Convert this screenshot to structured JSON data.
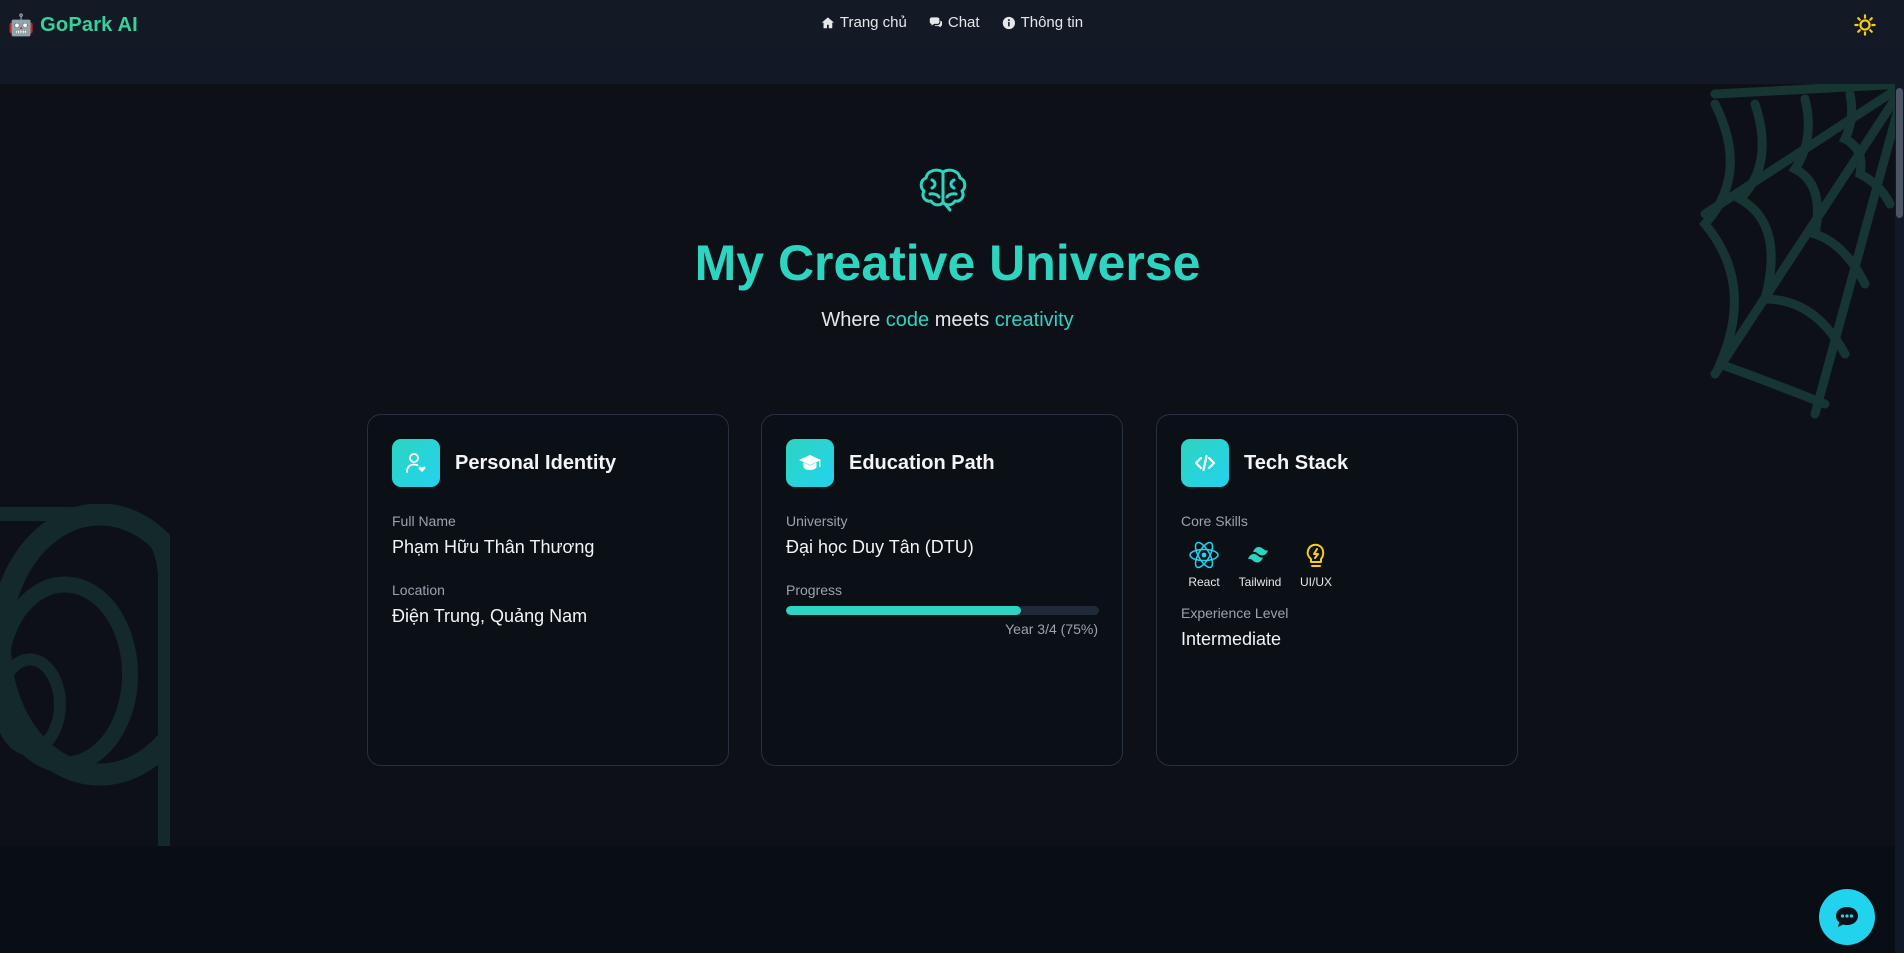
{
  "navbar": {
    "brand_icon": "🤖",
    "brand": "GoPark AI",
    "links": [
      {
        "icon": "home-icon",
        "label": "Trang chủ"
      },
      {
        "icon": "comments-icon",
        "label": "Chat"
      },
      {
        "icon": "info-icon",
        "label": "Thông tin"
      }
    ],
    "theme_icon": "sun-icon"
  },
  "hero": {
    "icon": "brain-icon",
    "title": "My Creative Universe",
    "subtitle_1": "Where ",
    "subtitle_accent_1": "code",
    "subtitle_2": " meets ",
    "subtitle_accent_2": "creativity"
  },
  "cards": {
    "identity": {
      "title": "Personal Identity",
      "icon": "user-heart-icon",
      "full_name_label": "Full Name",
      "full_name": "Phạm Hữu Thân Thương",
      "location_label": "Location",
      "location": "Điện Trung, Quảng Nam"
    },
    "education": {
      "title": "Education Path",
      "icon": "graduation-cap-icon",
      "university_label": "University",
      "university": "Đại học Duy Tân (DTU)",
      "progress_label": "Progress",
      "progress_percent": 75,
      "progress_text": "Year 3/4 (75%)"
    },
    "tech": {
      "title": "Tech Stack",
      "icon": "code-icon",
      "skills_label": "Core Skills",
      "skills": [
        {
          "icon": "react-icon",
          "name": "React"
        },
        {
          "icon": "tailwind-icon",
          "name": "Tailwind"
        },
        {
          "icon": "lightbulb-icon",
          "name": "UI/UX"
        }
      ],
      "experience_label": "Experience Level",
      "experience": "Intermediate"
    }
  },
  "colors": {
    "accent": "#2dd4bf",
    "brand": "#34d399",
    "background": "#0d1117"
  }
}
